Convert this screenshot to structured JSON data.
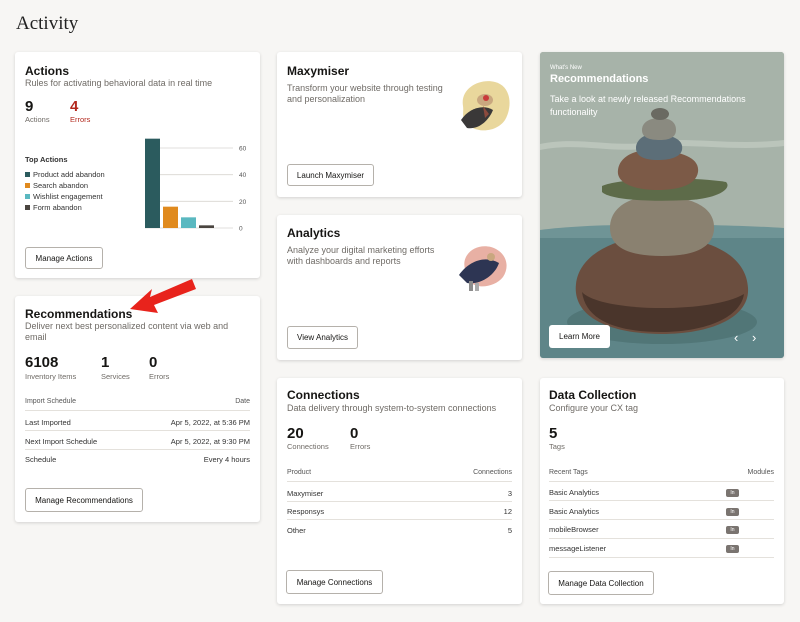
{
  "page_title": "Activity",
  "actions": {
    "title": "Actions",
    "subtitle": "Rules for activating behavioral data in real time",
    "stats": [
      {
        "value": "9",
        "label": "Actions"
      },
      {
        "value": "4",
        "label": "Errors"
      }
    ],
    "top_title": "Top Actions",
    "legend": [
      {
        "label": "Product add abandon",
        "color": "#2b5b5e"
      },
      {
        "label": "Search abandon",
        "color": "#e08a1e"
      },
      {
        "label": "Wishlist engagement",
        "color": "#5ab8c0"
      },
      {
        "label": "Form abandon",
        "color": "#4a4540"
      }
    ],
    "axis_ticks": [
      "60",
      "40",
      "20",
      "0"
    ],
    "button": "Manage Actions"
  },
  "chart_data": {
    "type": "bar",
    "categories": [
      "Product add abandon",
      "Search abandon",
      "Wishlist engagement",
      "Form abandon"
    ],
    "values": [
      67,
      16,
      8,
      2
    ],
    "ylim": [
      0,
      60
    ],
    "yticks": [
      0,
      20,
      40,
      60
    ],
    "colors": [
      "#2b5b5e",
      "#e08a1e",
      "#5ab8c0",
      "#4a4540"
    ],
    "grid": true
  },
  "recommendations": {
    "title": "Recommendations",
    "subtitle_1": "Deliver next best personalized content via web and",
    "subtitle_2": "email",
    "stats": [
      {
        "value": "6108",
        "label": "Inventory Items"
      },
      {
        "value": "1",
        "label": "Services"
      },
      {
        "value": "0",
        "label": "Errors"
      }
    ],
    "table_head": {
      "left": "Import Schedule",
      "right": "Date"
    },
    "rows": [
      {
        "label": "Last Imported",
        "value": "Apr 5, 2022, at 5:36 PM"
      },
      {
        "label": "Next Import Schedule",
        "value": "Apr 5, 2022, at 9:30 PM"
      },
      {
        "label": "Schedule",
        "value": "Every 4 hours"
      }
    ],
    "button": "Manage Recommendations"
  },
  "maxymiser": {
    "title": "Maxymiser",
    "subtitle_1": "Transform your website through testing",
    "subtitle_2": "and personalization",
    "button": "Launch Maxymiser"
  },
  "analytics": {
    "title": "Analytics",
    "subtitle_1": "Analyze your digital marketing efforts",
    "subtitle_2": "with dashboards and reports",
    "button": "View Analytics"
  },
  "whats_new": {
    "kicker": "What's New",
    "title": "Recommendations",
    "text_1": "Take a look at newly released Recommendations",
    "text_2": "functionality",
    "button": "Learn More",
    "prev": "‹",
    "next": "›"
  },
  "connections": {
    "title": "Connections",
    "subtitle": "Data delivery through system-to-system connections",
    "stats": [
      {
        "value": "20",
        "label": "Connections"
      },
      {
        "value": "0",
        "label": "Errors"
      }
    ],
    "table_head": {
      "left": "Product",
      "right": "Connections"
    },
    "rows": [
      {
        "label": "Maxymiser",
        "value": "3"
      },
      {
        "label": "Responsys",
        "value": "12"
      },
      {
        "label": "Other",
        "value": "5"
      }
    ],
    "button": "Manage Connections"
  },
  "data_collection": {
    "title": "Data Collection",
    "subtitle": "Configure your CX tag",
    "stat": {
      "value": "5",
      "label": "Tags"
    },
    "table_head": {
      "left": "Recent Tags",
      "right": "Modules"
    },
    "rows": [
      {
        "label": "Basic Analytics",
        "badge": "In"
      },
      {
        "label": "Basic Analytics",
        "badge": "In"
      },
      {
        "label": "mobileBrowser",
        "badge": "In"
      },
      {
        "label": "messageListener",
        "badge": "In"
      }
    ],
    "button": "Manage Data Collection"
  },
  "colors": {
    "error": "#b3281d",
    "arrow": "#e8231c",
    "hero_bg": "#9ba8a0"
  }
}
